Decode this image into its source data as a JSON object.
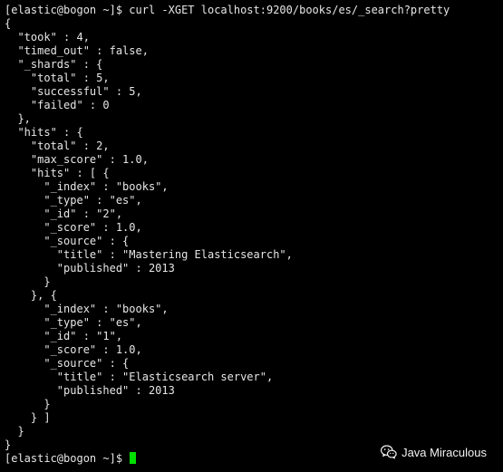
{
  "terminal": {
    "lines": [
      "[elastic@bogon ~]$ curl -XGET localhost:9200/books/es/_search?pretty",
      "{",
      "  \"took\" : 4,",
      "  \"timed_out\" : false,",
      "  \"_shards\" : {",
      "    \"total\" : 5,",
      "    \"successful\" : 5,",
      "    \"failed\" : 0",
      "  },",
      "  \"hits\" : {",
      "    \"total\" : 2,",
      "    \"max_score\" : 1.0,",
      "    \"hits\" : [ {",
      "      \"_index\" : \"books\",",
      "      \"_type\" : \"es\",",
      "      \"_id\" : \"2\",",
      "      \"_score\" : 1.0,",
      "      \"_source\" : {",
      "        \"title\" : \"Mastering Elasticsearch\",",
      "        \"published\" : 2013",
      "      }",
      "    }, {",
      "      \"_index\" : \"books\",",
      "      \"_type\" : \"es\",",
      "      \"_id\" : \"1\",",
      "      \"_score\" : 1.0,",
      "      \"_source\" : {",
      "        \"title\" : \"Elasticsearch server\",",
      "        \"published\" : 2013",
      "      }",
      "    } ]",
      "  }",
      "}"
    ],
    "prompt": "[elastic@bogon ~]$ ",
    "colors": {
      "background": "#000000",
      "foreground": "#e6e6e6",
      "cursor": "#00e000"
    }
  },
  "watermark": {
    "icon": "wechat-icon",
    "text": "Java Miraculous"
  }
}
